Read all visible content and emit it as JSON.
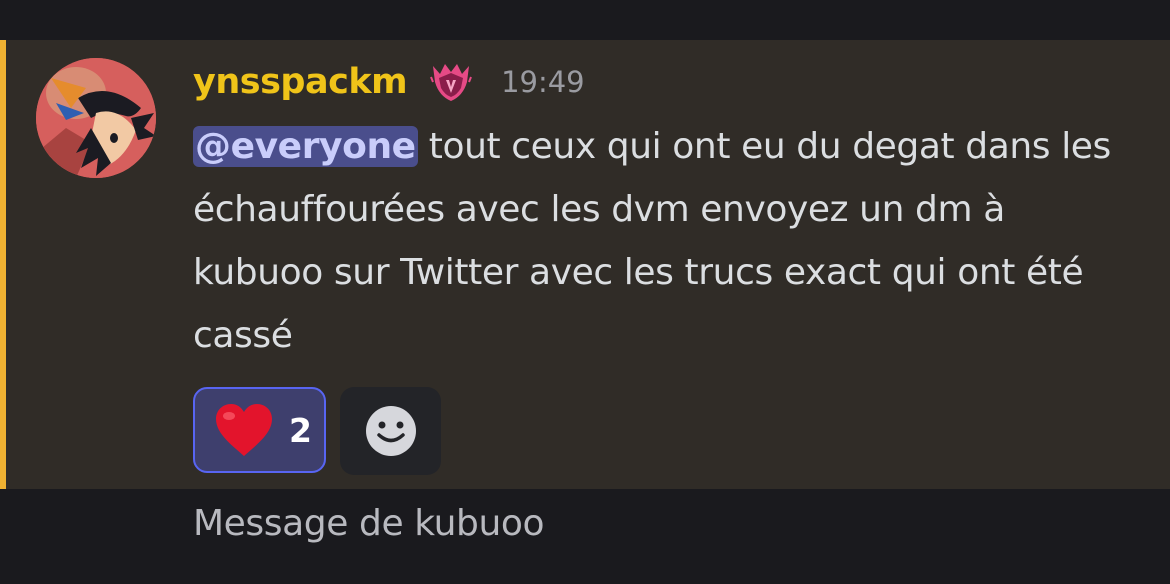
{
  "message": {
    "username": "ynsspackm",
    "timestamp": "19:49",
    "mention": "@everyone",
    "text": " tout ceux qui ont eu du degat dans les échauffourées avec les dvm envoyez un dm à kubuoo sur Twitter avec les trucs exact qui ont été cassé",
    "role_icon": "crowned-shield-icon",
    "avatar_icon": "anime-character-avatar",
    "reactions": [
      {
        "emoji": "heart-emoji",
        "count": "2"
      }
    ],
    "add_reaction_icon": "smiley-icon"
  },
  "composer": {
    "placeholder": "Message de kubuoo"
  },
  "colors": {
    "username": "#f0c419",
    "mention_bar": "#f0b232",
    "mention_bg": "#4a4e8c",
    "reaction_border": "#5865f2",
    "message_bg": "#302c27"
  }
}
